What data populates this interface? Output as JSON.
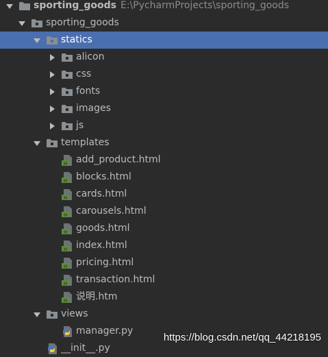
{
  "colors": {
    "background": "#2b2b2b",
    "selection": "#4b6eaf",
    "text": "#bbbbbb",
    "path_text": "#8c8c8c",
    "folder": "#8a8f93",
    "html_icon": "#5f8c3a",
    "python_blue": "#3f7cc0",
    "python_yellow": "#f2c94c"
  },
  "project": {
    "name": "sporting_goods",
    "path": "E:\\PycharmProjects\\sporting_goods"
  },
  "tree": {
    "app_folder": "sporting_goods",
    "statics": {
      "label": "statics",
      "children": [
        "alicon",
        "css",
        "fonts",
        "images",
        "js"
      ]
    },
    "templates": {
      "label": "templates",
      "files": [
        "add_product.html",
        "blocks.html",
        "cards.html",
        "carousels.html",
        "goods.html",
        "index.html",
        "pricing.html",
        "transaction.html",
        "说明.htm"
      ]
    },
    "views": {
      "label": "views",
      "files": [
        "manager.py"
      ]
    },
    "partial_file": "__init__.py"
  },
  "icons": {
    "folder": "folder-icon",
    "module_folder": "module-folder-icon",
    "html_file": "html-file-icon",
    "python_file": "python-file-icon"
  },
  "watermark": "https://blog.csdn.net/qq_44218195"
}
